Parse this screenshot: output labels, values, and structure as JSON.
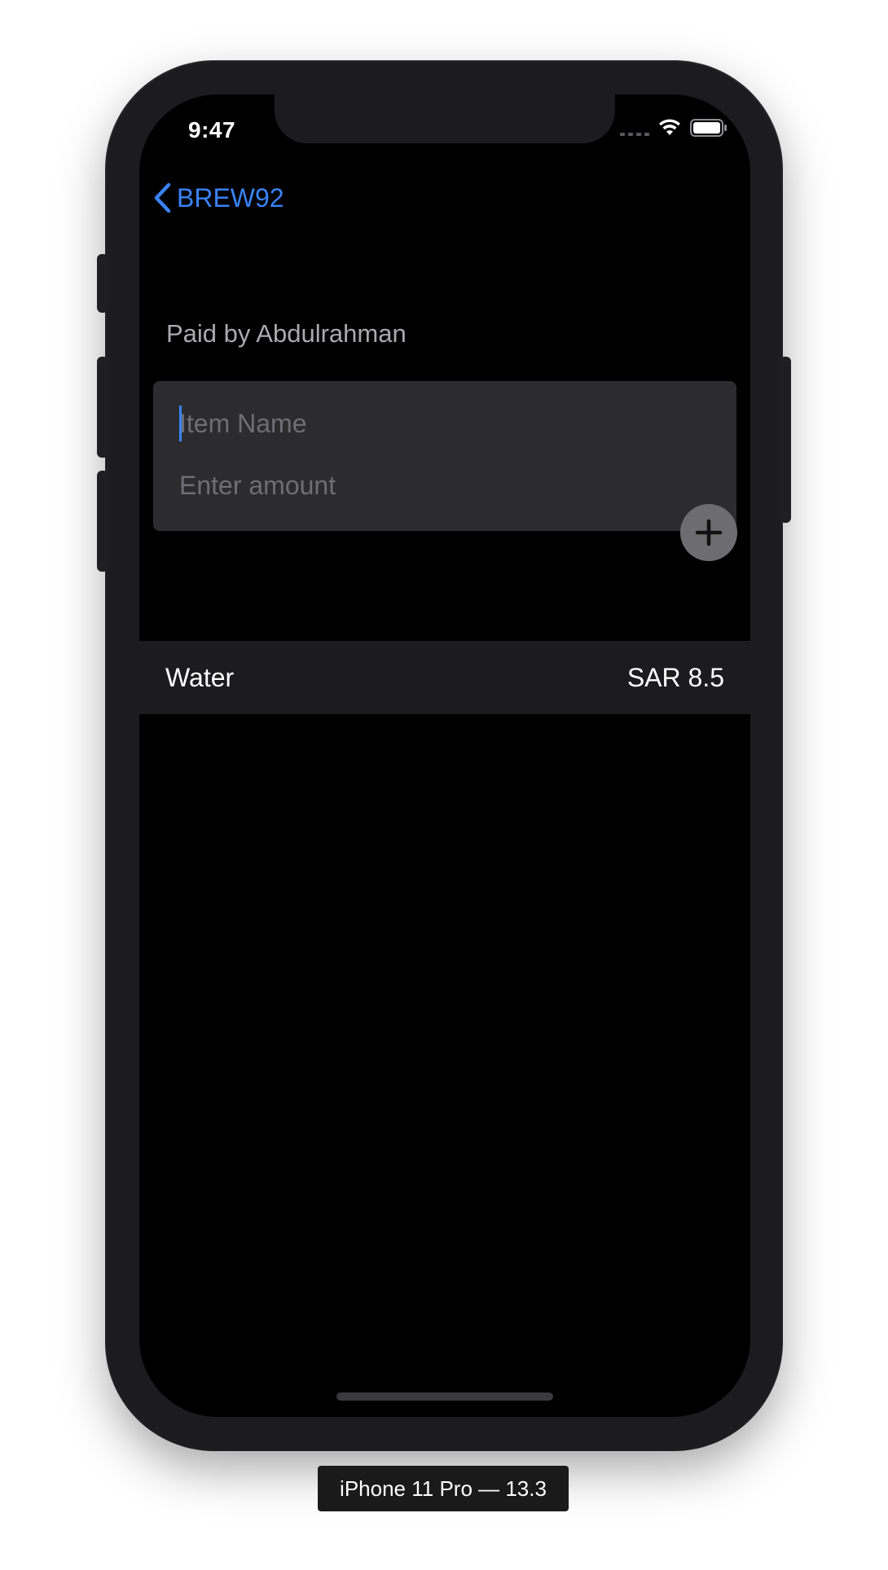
{
  "status_bar": {
    "time": "9:47"
  },
  "nav": {
    "back_label": "BREW92"
  },
  "bill": {
    "paid_by": "Paid by Abdulrahman"
  },
  "form": {
    "item_name_placeholder": "Item Name",
    "item_name_value": "",
    "amount_placeholder": "Enter amount",
    "amount_value": ""
  },
  "items": [
    {
      "name": "Water",
      "amount": "SAR 8.5"
    }
  ],
  "simulator": {
    "device_label": "iPhone 11 Pro — 13.3"
  },
  "colors": {
    "accent": "#3a82f7",
    "background": "#000000",
    "card": "#2c2c2e",
    "row": "#1c1c1e"
  }
}
